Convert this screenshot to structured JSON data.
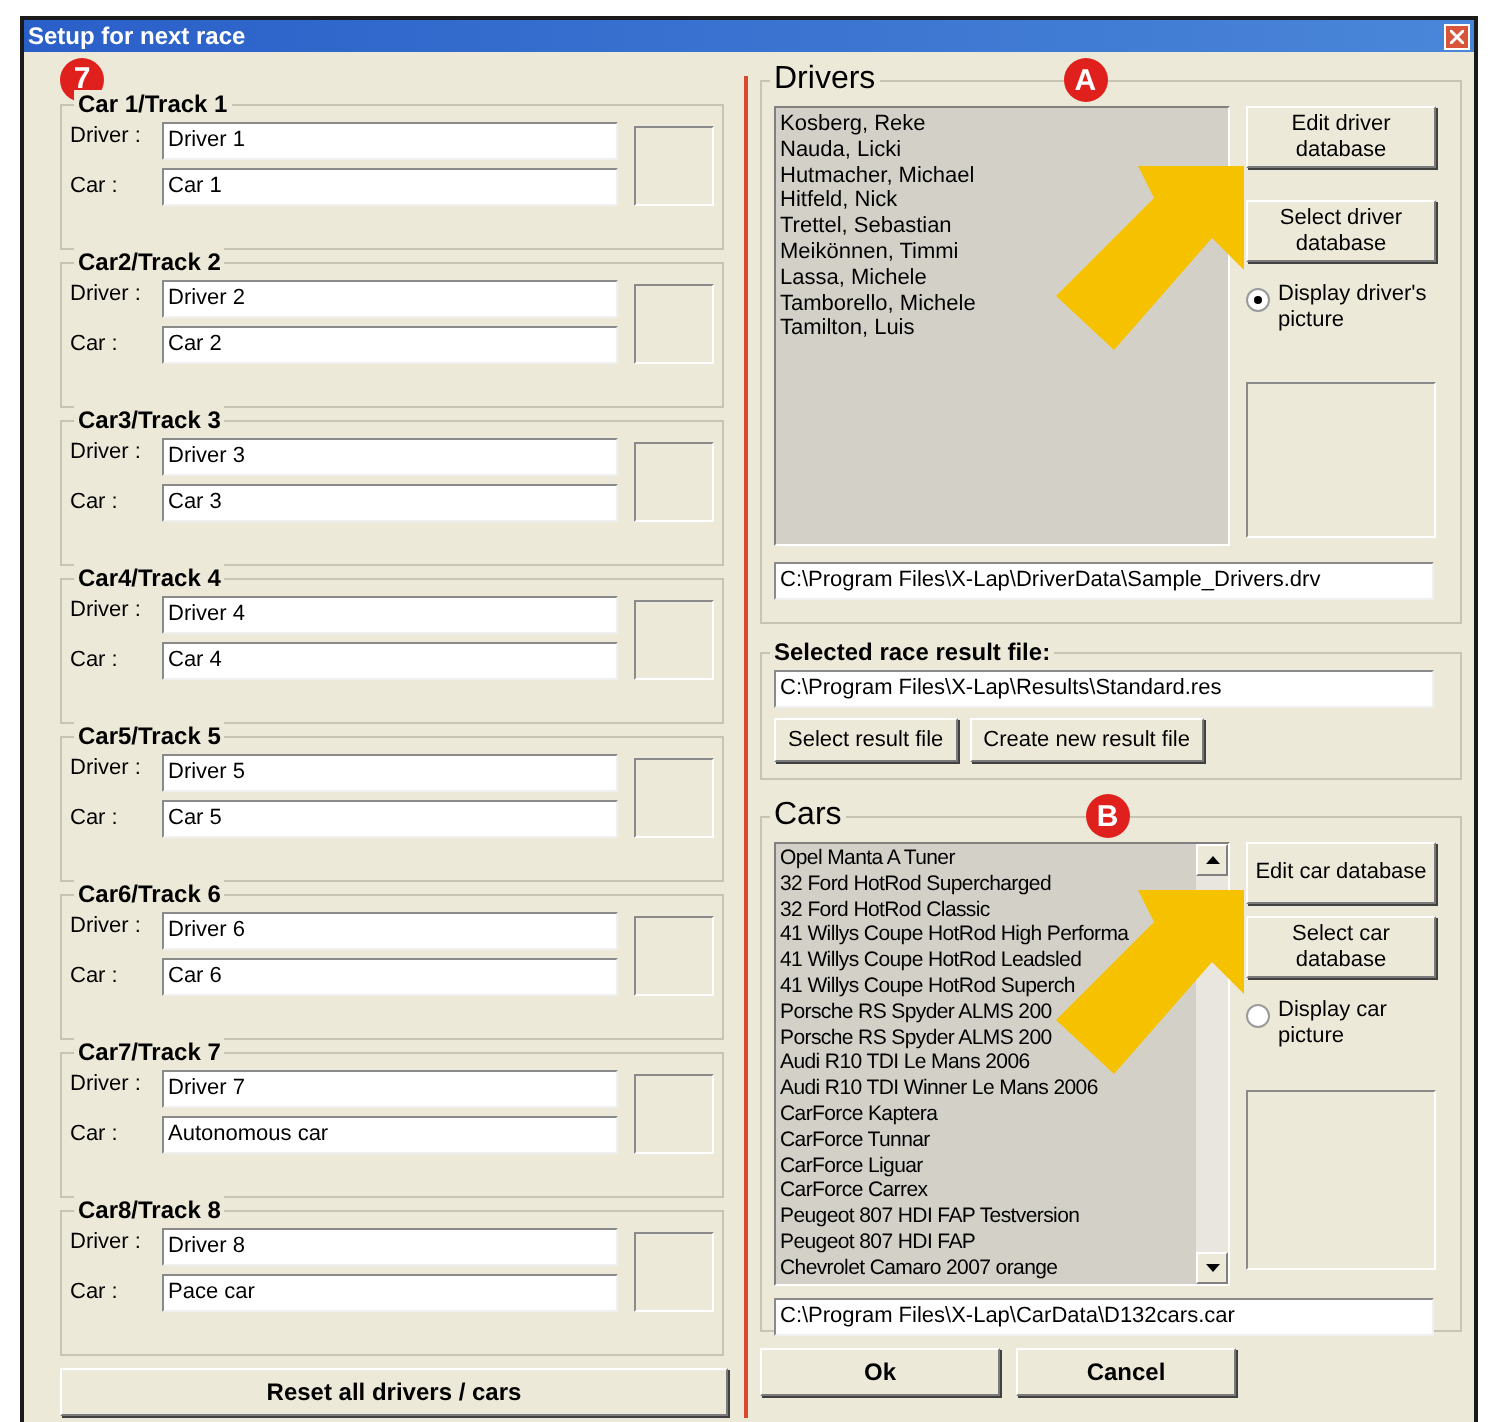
{
  "window": {
    "title": "Setup for next race",
    "badge": "7"
  },
  "slots": [
    {
      "title": "Car 1/Track 1",
      "driver_label": "Driver :",
      "driver": "Driver 1",
      "car_label": "Car :",
      "car": "Car 1"
    },
    {
      "title": "Car2/Track 2",
      "driver_label": "Driver :",
      "driver": "Driver 2",
      "car_label": "Car :",
      "car": "Car 2"
    },
    {
      "title": "Car3/Track 3",
      "driver_label": "Driver :",
      "driver": "Driver 3",
      "car_label": "Car :",
      "car": "Car 3"
    },
    {
      "title": "Car4/Track 4",
      "driver_label": "Driver :",
      "driver": "Driver 4",
      "car_label": "Car :",
      "car": "Car 4"
    },
    {
      "title": "Car5/Track 5",
      "driver_label": "Driver :",
      "driver": "Driver 5",
      "car_label": "Car :",
      "car": "Car 5"
    },
    {
      "title": "Car6/Track 6",
      "driver_label": "Driver :",
      "driver": "Driver 6",
      "car_label": "Car :",
      "car": "Car 6"
    },
    {
      "title": "Car7/Track 7",
      "driver_label": "Driver :",
      "driver": "Driver 7",
      "car_label": "Car :",
      "car": "Autonomous car"
    },
    {
      "title": "Car8/Track 8",
      "driver_label": "Driver :",
      "driver": "Driver 8",
      "car_label": "Car :",
      "car": "Pace car"
    }
  ],
  "reset_button": "Reset all drivers / cars",
  "drivers": {
    "title": "Drivers",
    "badge": "A",
    "items": [
      "Kosberg, Reke",
      "Nauda, Licki",
      "Hutmacher, Michael",
      "Hitfeld, Nick",
      "Trettel, Sebastian",
      "Meikönnen, Timmi",
      "Lassa, Michele",
      "Tamborello, Michele",
      "Tamilton, Luis"
    ],
    "buttons": [
      "Edit driver database",
      "Select driver database"
    ],
    "radio": {
      "label": "Display driver's picture",
      "selected": true
    },
    "path": "C:\\Program Files\\X-Lap\\DriverData\\Sample_Drivers.drv"
  },
  "result_file": {
    "title": "Selected race result file:",
    "path": "C:\\Program Files\\X-Lap\\Results\\Standard.res",
    "buttons": [
      "Select result file",
      "Create new result file"
    ]
  },
  "cars": {
    "title": "Cars",
    "badge": "B",
    "items": [
      "Opel Manta A Tuner",
      "32 Ford HotRod Supercharged",
      "32 Ford HotRod Classic",
      "41 Willys Coupe HotRod High Performa",
      "41 Willys Coupe HotRod Leadsled",
      "41 Willys Coupe HotRod Superch",
      "Porsche RS Spyder ALMS 200",
      "Porsche RS Spyder ALMS 200",
      "Audi R10 TDI Le Mans 2006",
      "Audi R10 TDI Winner Le Mans 2006",
      "CarForce Kaptera",
      "CarForce Tunnar",
      "CarForce Liguar",
      "CarForce Carrex",
      "Peugeot 807 HDI FAP Testversion",
      "Peugeot 807 HDI FAP",
      "Chevrolet Camaro 2007 orange"
    ],
    "buttons": [
      "Edit car database",
      "Select car database"
    ],
    "radio": {
      "label": "Display car picture",
      "selected": false
    },
    "path": "C:\\Program Files\\X-Lap\\CarData\\D132cars.car"
  },
  "ok_button": "Ok",
  "cancel_button": "Cancel"
}
